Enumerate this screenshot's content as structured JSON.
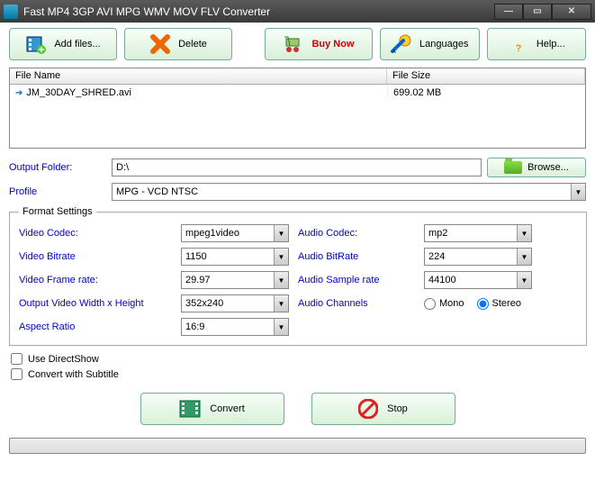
{
  "title": "Fast MP4 3GP AVI MPG WMV MOV FLV Converter",
  "toolbar": {
    "add_files": "Add files...",
    "delete": "Delete",
    "buy_now": "Buy Now",
    "languages": "Languages",
    "help": "Help..."
  },
  "filelist": {
    "col_name": "File Name",
    "col_size": "File Size",
    "rows": [
      {
        "name": "JM_30DAY_SHRED.avi",
        "size": "699.02 MB"
      }
    ]
  },
  "output": {
    "folder_label": "Output Folder:",
    "folder_value": "D:\\",
    "browse": "Browse...",
    "profile_label": "Profile",
    "profile_value": "MPG - VCD NTSC"
  },
  "format": {
    "legend": "Format Settings",
    "video_codec_label": "Video Codec:",
    "video_codec": "mpeg1video",
    "video_bitrate_label": "Video Bitrate",
    "video_bitrate": "1150",
    "video_framerate_label": "Video Frame rate:",
    "video_framerate": "29.97",
    "video_size_label": "Output Video Width x Height",
    "video_size": "352x240",
    "aspect_label": "Aspect Ratio",
    "aspect": "16:9",
    "audio_codec_label": "Audio Codec:",
    "audio_codec": "mp2",
    "audio_bitrate_label": "Audio BitRate",
    "audio_bitrate": "224",
    "audio_sample_label": "Audio Sample rate",
    "audio_sample": "44100",
    "audio_channels_label": "Audio Channels",
    "mono": "Mono",
    "stereo": "Stereo"
  },
  "options": {
    "directshow": "Use DirectShow",
    "subtitle": "Convert with Subtitle"
  },
  "actions": {
    "convert": "Convert",
    "stop": "Stop"
  }
}
